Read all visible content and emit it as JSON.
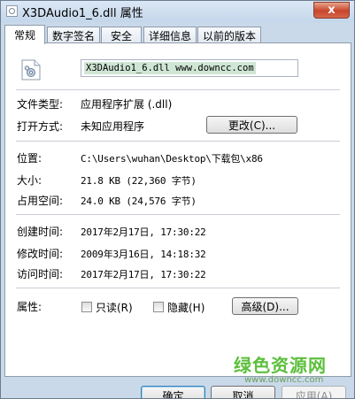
{
  "window": {
    "title": "X3DAudio1_6.dll 属性",
    "close_label": "x"
  },
  "tabs": [
    {
      "label": "常规",
      "active": true
    },
    {
      "label": "数字签名",
      "active": false
    },
    {
      "label": "安全",
      "active": false
    },
    {
      "label": "详细信息",
      "active": false
    },
    {
      "label": "以前的版本",
      "active": false
    }
  ],
  "general": {
    "file_name": "X3DAudio1_6.dll www.downcc.com",
    "file_type": {
      "label": "文件类型:",
      "value": "应用程序扩展 (.dll)"
    },
    "opens_with": {
      "label": "打开方式:",
      "value": "未知应用程序",
      "button": "更改(C)..."
    },
    "location": {
      "label": "位置:",
      "value": "C:\\Users\\wuhan\\Desktop\\下载包\\x86"
    },
    "size": {
      "label": "大小:",
      "value": "21.8 KB (22,360 字节)"
    },
    "size_on_disk": {
      "label": "占用空间:",
      "value": "24.0 KB (24,576 字节)"
    },
    "created": {
      "label": "创建时间:",
      "value": "2017年2月17日, 17:30:22"
    },
    "modified": {
      "label": "修改时间:",
      "value": "2009年3月16日, 14:18:32"
    },
    "accessed": {
      "label": "访问时间:",
      "value": "2017年2月17日, 17:30:22"
    },
    "attributes": {
      "label": "属性:",
      "readonly_label": "只读(R)",
      "readonly_checked": false,
      "hidden_label": "隐藏(H)",
      "hidden_checked": false,
      "advanced_button": "高级(D)..."
    }
  },
  "footer": {
    "ok": "确定",
    "cancel": "取消",
    "apply": "应用(A)"
  },
  "watermark": {
    "main": "绿色资源网",
    "sub": "www.downcc.com"
  },
  "colors": {
    "frame": "#c9d9ea",
    "close": "#c8442a",
    "selection": "#cfe6d4",
    "watermark": "#5cbf3c"
  }
}
